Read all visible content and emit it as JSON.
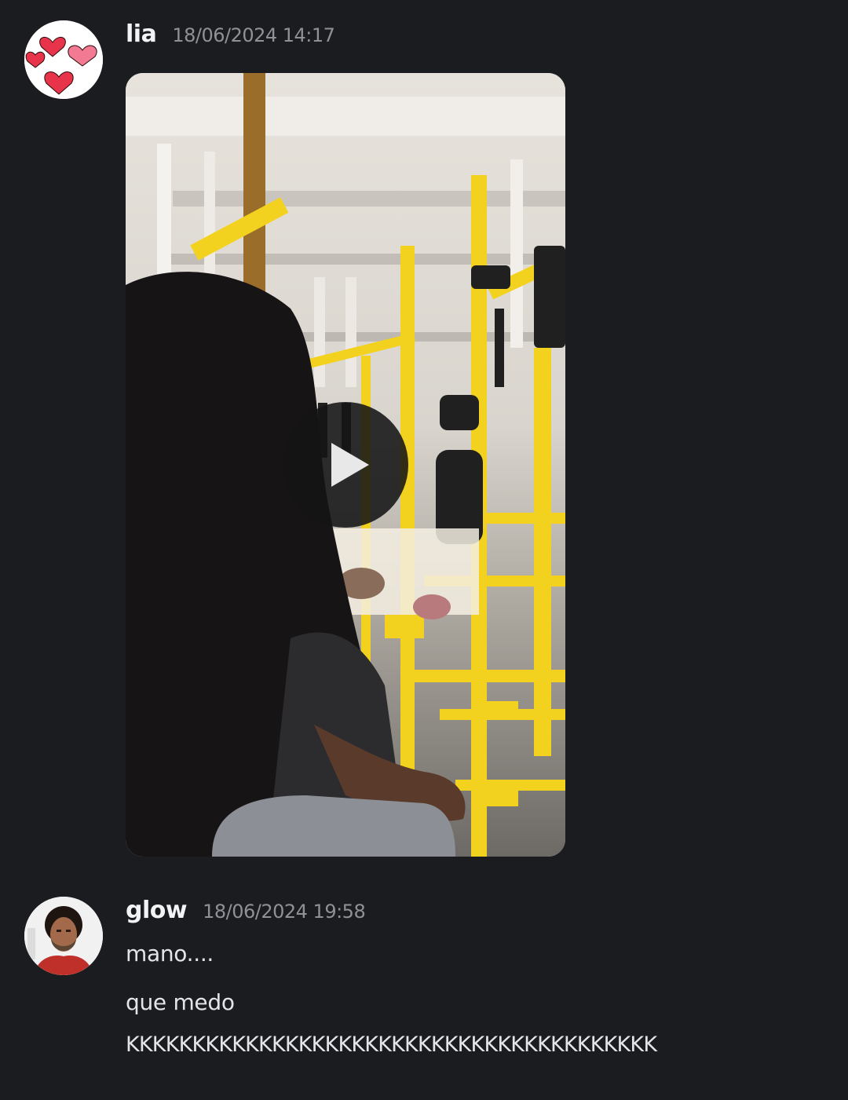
{
  "messages": [
    {
      "author": "lia",
      "timestamp": "18/06/2024 14:17",
      "avatar_icon": "hearts-avatar-icon",
      "attachment": {
        "type": "video",
        "play_icon": "play-icon"
      }
    },
    {
      "author": "glow",
      "timestamp": "18/06/2024 19:58",
      "avatar_icon": "portrait-avatar-icon",
      "lines": [
        "mano....",
        "que medo",
        "KKKKKKKKKKKKKKKKKKKKKKKKKKKKKKKKKKKKKKKK"
      ]
    }
  ],
  "colors": {
    "background": "#1b1c20",
    "username": "#f2f3f5",
    "timestamp": "#8e9297",
    "text": "#e3e5e8",
    "bus_rail_yellow": "#f2d21e"
  }
}
